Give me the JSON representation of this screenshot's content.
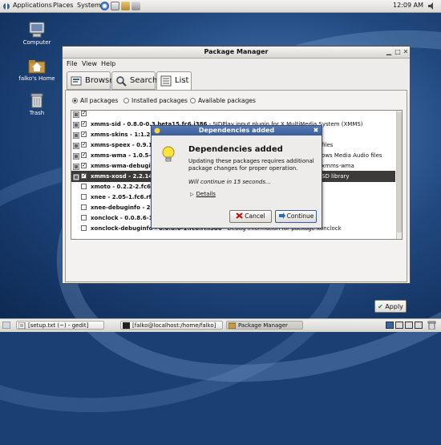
{
  "top_panel": {
    "menus": [
      "Applications",
      "Places",
      "System"
    ],
    "clock": "12:09 AM"
  },
  "desktop_icons": [
    {
      "label": "Computer"
    },
    {
      "label": "falko's Home"
    },
    {
      "label": "Trash"
    }
  ],
  "window": {
    "title": "Package Manager",
    "menu": [
      "File",
      "View",
      "Help"
    ],
    "tabs": [
      {
        "label": "Browse",
        "icon": "browse-icon"
      },
      {
        "label": "Search",
        "icon": "search-icon"
      },
      {
        "label": "List",
        "icon": "list-icon"
      }
    ],
    "filters": [
      {
        "label": "All packages",
        "selected": true
      },
      {
        "label": "Installed packages",
        "selected": false
      },
      {
        "label": "Available packages",
        "selected": false
      }
    ],
    "packages": [
      {
        "checked": true,
        "installed": true,
        "name": "",
        "rest": "",
        "right": ""
      },
      {
        "checked": true,
        "installed": true,
        "name": "xmms-sid - 0.8.0-0.3.beta15.fc6.i386",
        "rest": " - SIDPlay input plugin for X MultiMedia System (XMMS)",
        "right": ""
      },
      {
        "checked": true,
        "installed": true,
        "name": "xmms-skins - 1:1.2.",
        "rest": "",
        "right": ""
      },
      {
        "checked": true,
        "installed": true,
        "name": "xmms-speex - 0.9.1",
        "rest": "",
        "right": "files"
      },
      {
        "checked": true,
        "installed": true,
        "name": "xmms-wma - 1.0.5-",
        "rest": "",
        "right": "ows Media Audio files"
      },
      {
        "checked": true,
        "installed": true,
        "name": "xmms-wma-debugi",
        "rest": "",
        "right": "xmms-wma"
      },
      {
        "checked": true,
        "installed": true,
        "name": "xmms-xosd - 2.2.14",
        "rest": "",
        "right": "SD library",
        "selected": true
      },
      {
        "checked": false,
        "installed": false,
        "name": "xmoto - 0.2.2-2.fc6",
        "rest": "",
        "right": ""
      },
      {
        "checked": false,
        "installed": false,
        "name": "xnee - 2.05-1.fc6.rf",
        "rest": "",
        "right": ""
      },
      {
        "checked": false,
        "installed": false,
        "name": "xnee-debuginfo - 2.",
        "rest": "",
        "right": ""
      },
      {
        "checked": false,
        "installed": false,
        "name": "xonclock - 0.0.8.6-1",
        "rest": "",
        "right": ""
      },
      {
        "checked": false,
        "installed": false,
        "name": "xonclock-debuginfo - 0.0.8.6-1.fc6.rf.i386",
        "rest": " - Debug information for package xonclock",
        "right": ""
      }
    ],
    "apply_label": "Apply"
  },
  "dialog": {
    "title": "Dependencies added",
    "heading": "Dependencies added",
    "body": "Updating these packages requires additional package changes for proper operation.",
    "wait": "Will continue in 15 seconds...",
    "details": "Details",
    "cancel": "Cancel",
    "continue": "Continue"
  },
  "taskbar": [
    {
      "label": "[setup.txt (~) - gedit]",
      "active": false
    },
    {
      "label": "[falko@localhost:/home/falko]",
      "active": false
    },
    {
      "label": "Package Manager",
      "active": true
    }
  ],
  "colors": {
    "dialog_title": "#3a5c99",
    "selected_row": "#3d3b39",
    "desktop": "#21497f"
  }
}
